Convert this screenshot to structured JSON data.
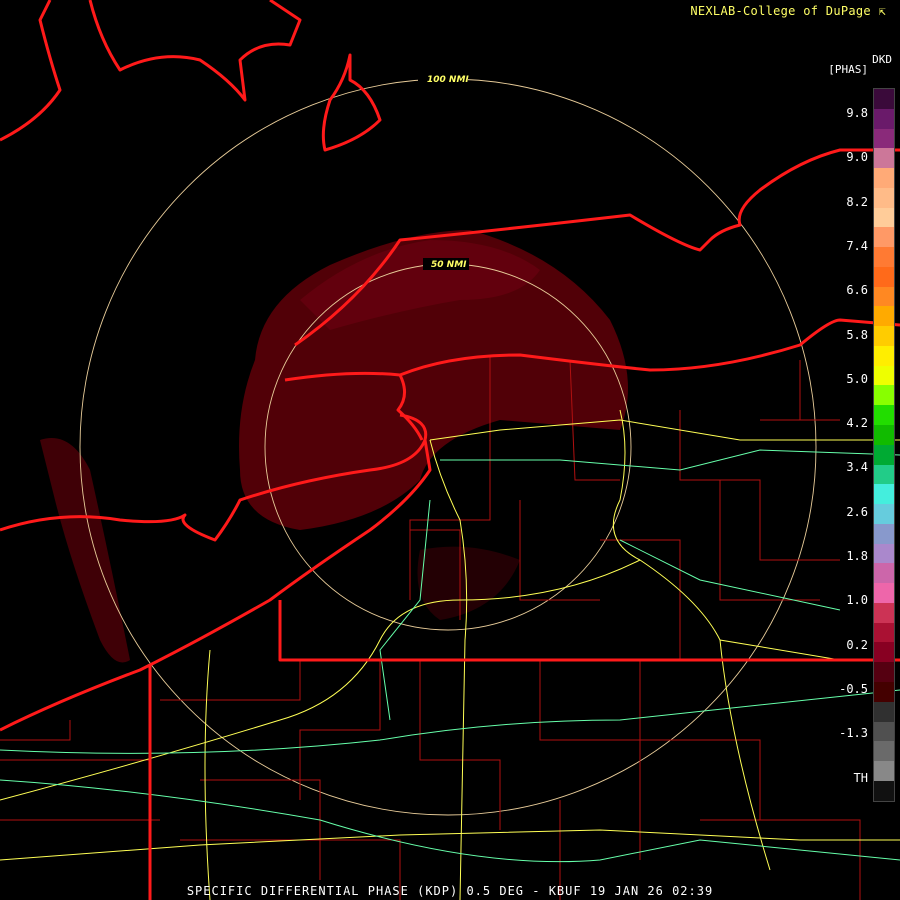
{
  "header": {
    "credit": "NEXLAB-College of DuPage ⇱"
  },
  "footer": {
    "caption": "SPECIFIC DIFFERENTIAL PHASE (KDP) 0.5 DEG - KBUF 19 JAN 26 02:39"
  },
  "legend": {
    "product": "DKD",
    "units": "[PHAS]",
    "ticks": [
      "9.8",
      "9.0",
      "8.2",
      "7.4",
      "6.6",
      "5.8",
      "5.0",
      "4.2",
      "3.4",
      "2.6",
      "1.8",
      "1.0",
      "0.2",
      "-0.5",
      "-1.3",
      "TH"
    ],
    "colors": [
      "#3a0a3a",
      "#6a1a6a",
      "#8a2a7a",
      "#cc7799",
      "#ffaa77",
      "#ffbb88",
      "#ffcc99",
      "#ff9966",
      "#ff7a33",
      "#ff6a1a",
      "#ff8822",
      "#ffaa00",
      "#ffcc00",
      "#ffee00",
      "#eeff00",
      "#88ff00",
      "#22dd00",
      "#11bb00",
      "#00aa33",
      "#22cc88",
      "#44eedd",
      "#66ccdd",
      "#8899cc",
      "#aa88cc",
      "#cc66aa",
      "#ee66aa",
      "#cc3355",
      "#aa1133",
      "#880022",
      "#550011",
      "#440000",
      "#303030",
      "#505050",
      "#6a6a6a",
      "#888888",
      "#111111"
    ]
  },
  "rings": [
    {
      "label": "100 NMI"
    },
    {
      "label": "50 NMI"
    }
  ]
}
